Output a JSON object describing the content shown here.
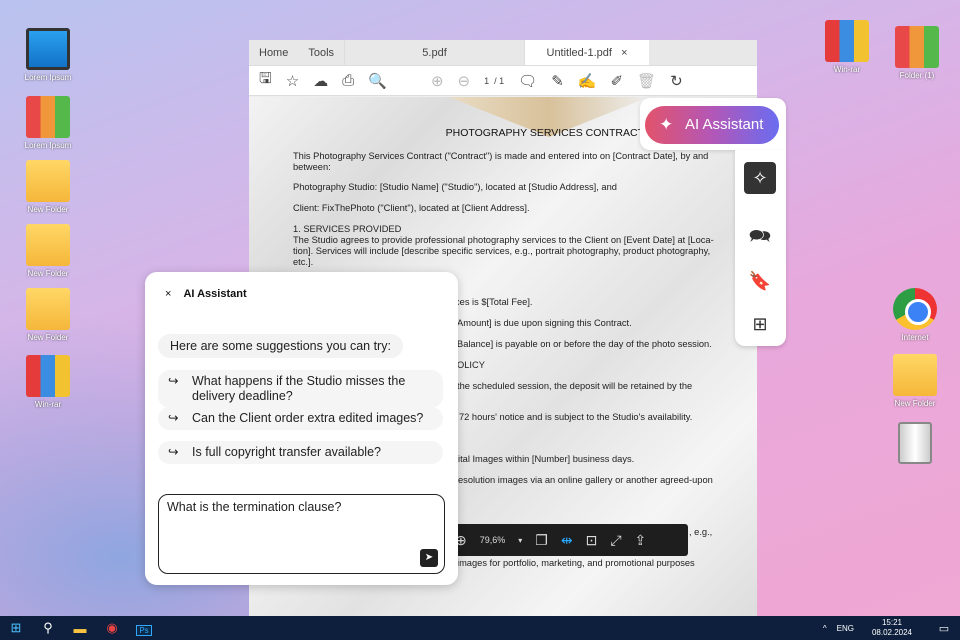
{
  "desktop": {
    "left": [
      "Lorem Ipsum",
      "Lorem Ipsum",
      "New Folder",
      "New Folder",
      "New Folder",
      "Win-rar"
    ],
    "right_top": [
      "Win-rar",
      "Folder (1)"
    ],
    "right": [
      "Internet",
      "New Folder",
      ""
    ]
  },
  "window": {
    "tabs": [
      "Home",
      "Tools",
      "5.pdf",
      "Untitled-1.pdf"
    ],
    "close": "×",
    "page_current": "1",
    "page_total": "/ 1"
  },
  "document": {
    "title": "PHOTOGRAPHY SERVICES CONTRACT",
    "lines": [
      "This Photography Services Contract (\"Contract\") is made and entered into on [Contract Date], by and",
      "between:",
      "Photography Studio: [Studio Name] (\"Studio\"), located at [Studio Address], and",
      "Client: FixThePhoto (\"Client\"), located at [Client Address].",
      "1. SERVICES PROVIDED",
      "The Studio agrees to provide professional photography services to the Client on [Event Date] at [Loca-",
      "tion]. Services will include [describe specific services, e.g., portrait photography, product photography,",
      "etc.].",
      "ces is $[Total Fee].",
      "Amount] is due upon signing this Contract.",
      "Balance] is payable on or before the day of the photo session.",
      "OLICY",
      "the scheduled session, the deposit will be retained by the",
      "72 hours' notice and is subject to the Studio's availability.",
      "ital Images within [Number] business days.",
      "esolution images via an online gallery or another agreed-upon",
      ", e.g.,",
      "images for portfolio, marketing, and promotional purposes"
    ]
  },
  "ai_button": {
    "label": "AI Assistant"
  },
  "bottom_toolbar": {
    "zoom": "79,6%"
  },
  "panel": {
    "title": "AI Assistant",
    "close": "×",
    "intro": "Here are some suggestions you can try:",
    "suggestions": [
      "What happens if the Studio misses the delivery deadline?",
      "Can the Client order extra edited images?",
      "Is full copyright transfer available?"
    ],
    "input": "What is the termination clause?"
  },
  "taskbar": {
    "lang": "ENG",
    "time": "15:21",
    "date": "08.02.2024"
  }
}
